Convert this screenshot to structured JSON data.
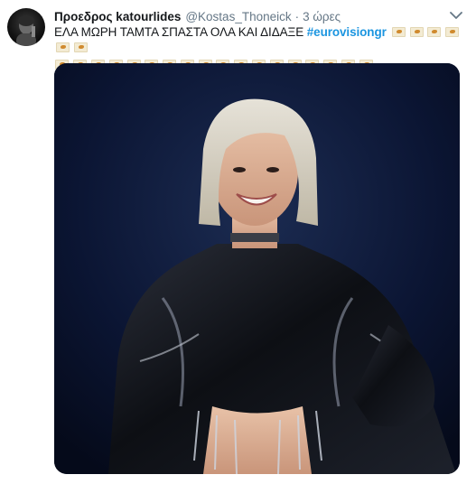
{
  "tweet": {
    "display_name": "Προεδρος katourlides",
    "handle": "@Kostas_Thoneick",
    "separator": "·",
    "time": "3 ώρες",
    "text": "ΕΛΑ ΜΩΡΗ ΤΑΜΤΑ ΣΠΑΣΤΑ ΟΛΑ ΚΑΙ ΔΙΔΑΞΕ",
    "hashtag": "#eurovisiongr",
    "flags_row1_count": 6,
    "flags_row2_count": 18,
    "flag_icon": "cyprus-flag-icon"
  },
  "icons": {
    "more": "chevron-down-icon",
    "avatar": "avatar"
  },
  "colors": {
    "hashtag": "#1b95e0",
    "meta": "#657786",
    "text": "#14171a",
    "photo_bg": "#0a1226"
  }
}
